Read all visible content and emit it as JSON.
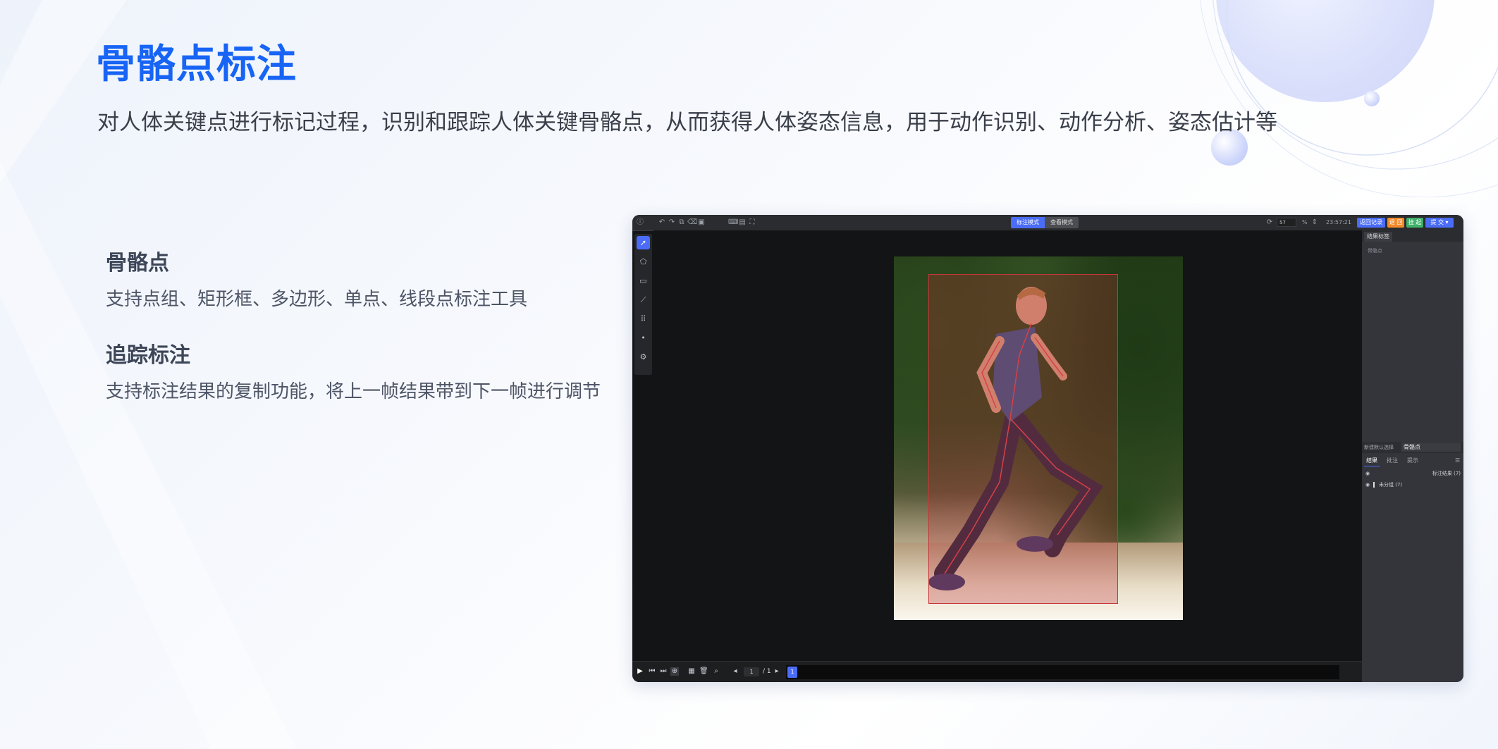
{
  "page": {
    "title": "骨骼点标注",
    "subtitle": "对人体关键点进行标记过程，识别和跟踪人体关键骨骼点，从而获得人体姿态信息，用于动作识别、动作分析、姿态估计等"
  },
  "features": [
    {
      "title": "骨骼点",
      "desc": "支持点组、矩形框、多边形、单点、线段点标注工具"
    },
    {
      "title": "追踪标注",
      "desc": "支持标注结果的复制功能，将上一帧结果带到下一帧进行调节"
    }
  ],
  "app": {
    "topbar": {
      "mode_label": "标注模式",
      "view_mode_label": "查看模式",
      "counter_value": "57",
      "zoom_label": "%",
      "timer": "23:57:21",
      "history_btn": "返回记录",
      "reject_btn": "退 回",
      "skip_btn": "挂 起",
      "submit_btn": "提 交"
    },
    "sidebar": {
      "tab_label": "结果标签",
      "placeholder": "骨骼点",
      "select_label": "新建默认选择",
      "select_value": "骨骼点",
      "tabs": [
        "结果",
        "批注",
        "提示"
      ],
      "result_header": "标注结果 (7)",
      "group_label": "未分组 (7)"
    },
    "bottombar": {
      "page_current": "1",
      "page_total": "/ 1",
      "frame_number": "1"
    }
  },
  "colors": {
    "title_blue": "#1764f5",
    "accent_blue": "#4a6cf7",
    "reject_orange": "#f08a2a",
    "skip_green": "#3fb16a"
  }
}
